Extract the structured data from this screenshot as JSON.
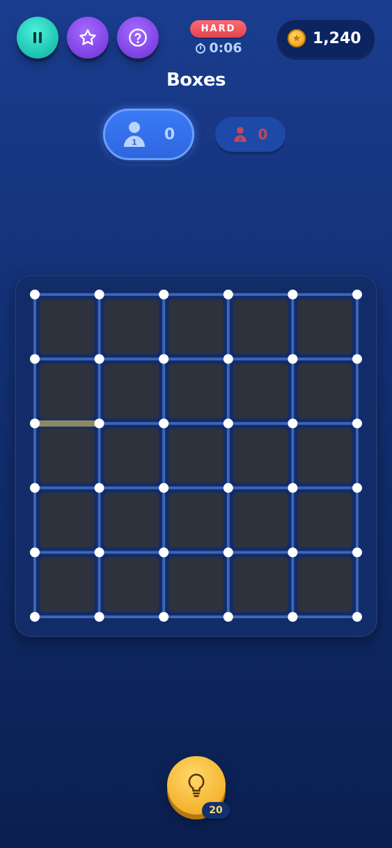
{
  "header": {
    "difficulty": "HARD",
    "timer": "0:06",
    "coins": "1,240"
  },
  "icons": {
    "pause": "pause-icon",
    "star": "star-icon",
    "help": "question-icon",
    "timer": "stopwatch-icon",
    "coin": "coin-icon",
    "player": "person-icon",
    "hint": "lightbulb-icon"
  },
  "title": "Boxes",
  "players": [
    {
      "badge": "1",
      "score": "0",
      "active": true,
      "color": "#3a7af5"
    },
    {
      "badge": "2",
      "score": "0",
      "active": false,
      "color": "#c4475a"
    }
  ],
  "board": {
    "rows": 5,
    "cols": 5,
    "drawn_lines": [
      {
        "orientation": "horizontal",
        "row": 2,
        "col": 0,
        "color": "#8c8a62"
      }
    ],
    "cell_color": "#2e323d",
    "line_color": "#4f78cf",
    "dot_color": "#ffffff"
  },
  "hint": {
    "count": "20"
  }
}
